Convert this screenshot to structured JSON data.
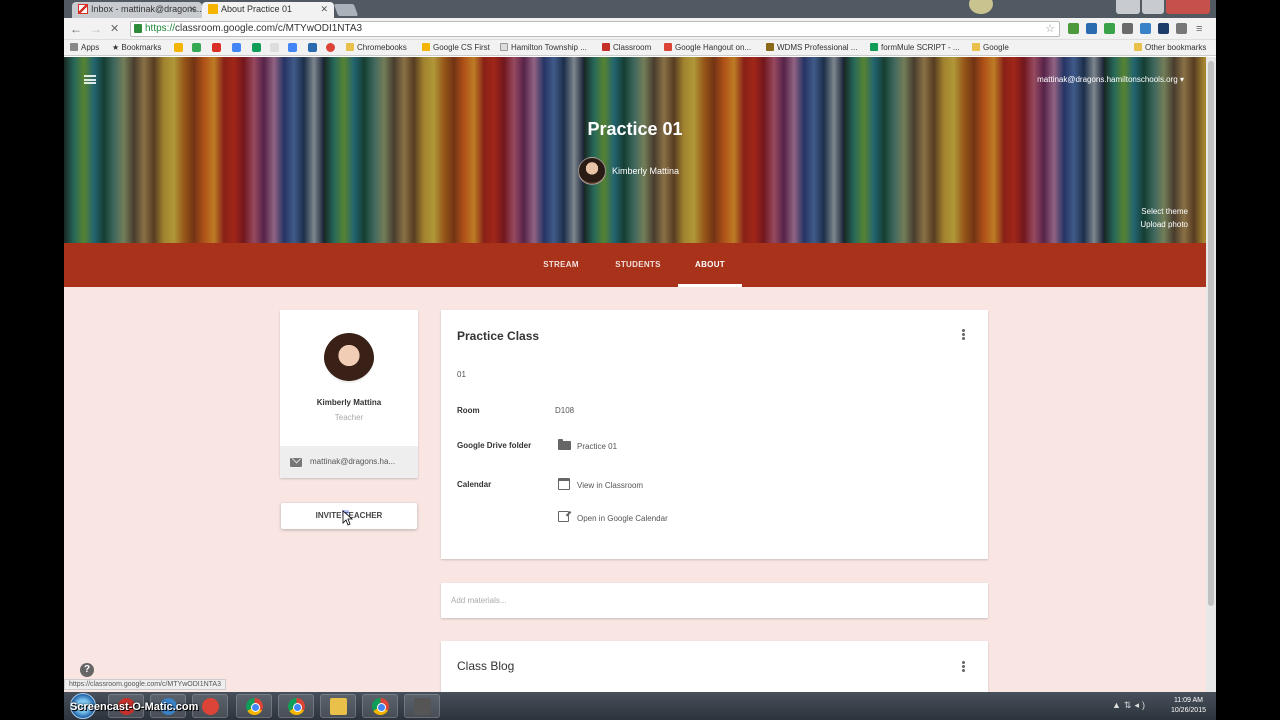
{
  "browser": {
    "tabs": [
      {
        "label": "Inbox - mattinak@dragons...",
        "active": false,
        "icon": "gmail-icon"
      },
      {
        "label": "About Practice 01",
        "active": true,
        "icon": "classroom-icon"
      }
    ],
    "url_scheme": "https://",
    "url_rest": "classroom.google.com/c/MTYwODI1NTA3",
    "bookmarks": [
      {
        "label": "Apps"
      },
      {
        "label": "Bookmarks"
      },
      {
        "label": "Chromebooks"
      },
      {
        "label": "Google CS First"
      },
      {
        "label": "Hamilton Township ..."
      },
      {
        "label": "Classroom"
      },
      {
        "label": "Google Hangout on..."
      },
      {
        "label": "WDMS Professional ..."
      },
      {
        "label": "formMule SCRIPT - ..."
      },
      {
        "label": "Google"
      }
    ],
    "other_bookmarks": "Other bookmarks"
  },
  "header": {
    "account": "mattinak@dragons.hamiltonschools.org",
    "class_title": "Practice 01",
    "teacher_name": "Kimberly Mattina",
    "select_theme": "Select theme",
    "upload_photo": "Upload photo"
  },
  "nav": {
    "stream": "STREAM",
    "students": "STUDENTS",
    "about": "ABOUT",
    "active": "about",
    "bar_color": "#a8321a"
  },
  "teacher_card": {
    "name": "Kimberly Mattina",
    "role": "Teacher",
    "email": "mattinak@dragons.ha..."
  },
  "invite_button": "INVITE TEACHER",
  "about": {
    "title": "Practice Class",
    "section": "01",
    "room_label": "Room",
    "room_value": "D108",
    "drive_label": "Google Drive folder",
    "drive_value": "Practice 01",
    "calendar_label": "Calendar",
    "calendar_view": "View in Classroom",
    "calendar_open": "Open in Google Calendar"
  },
  "materials_placeholder": "Add materials...",
  "blog_title": "Class Blog",
  "status_url": "https://classroom.google.com/c/MTYwODI1NTA3",
  "watermark": "Screencast-O-Matic.com",
  "clock": {
    "time": "11:09 AM",
    "date": "10/26/2015"
  },
  "colors": {
    "page_bg": "#f9e6e3",
    "accent": "#a8321a"
  }
}
